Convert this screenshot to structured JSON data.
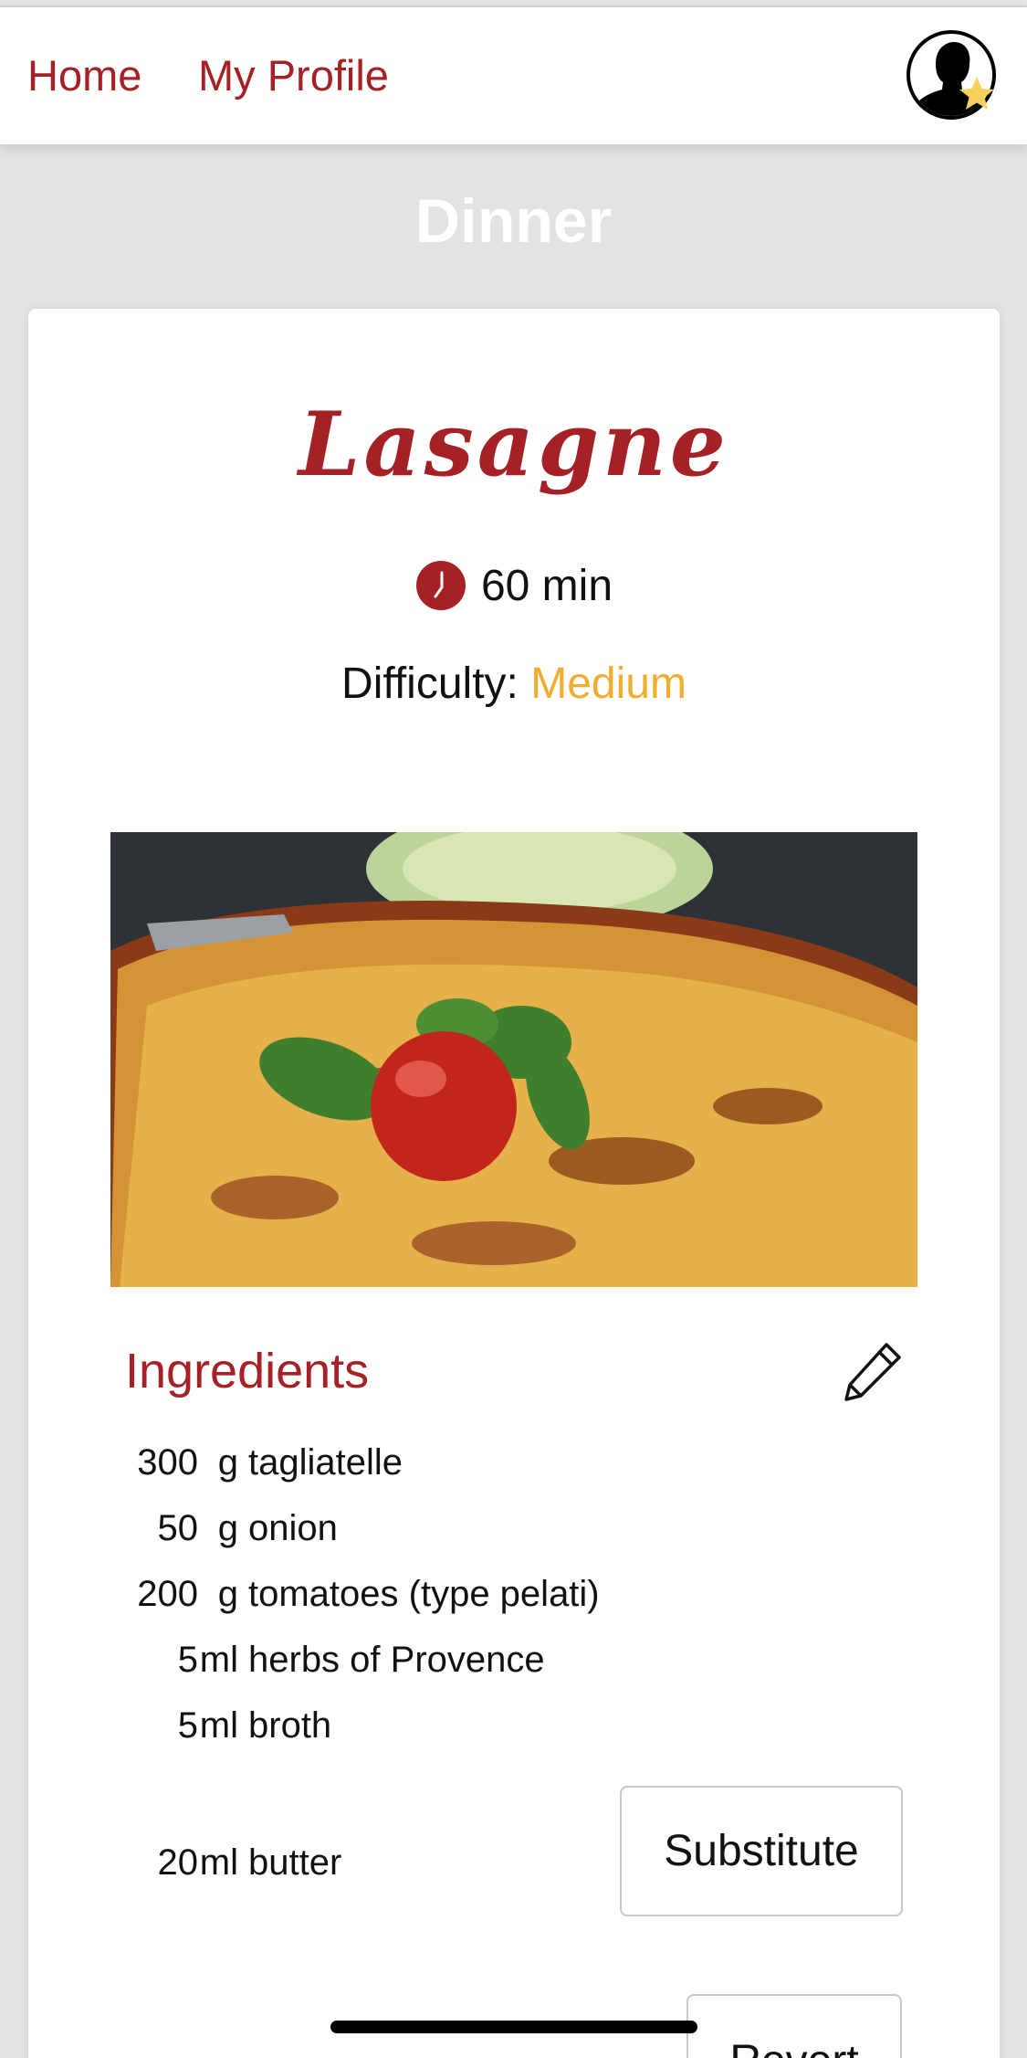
{
  "nav": {
    "home_label": "Home",
    "profile_label": "My Profile",
    "avatar_icon": "user-avatar-with-star-icon"
  },
  "category": "Dinner",
  "recipe": {
    "title": "Lasagne",
    "time_icon": "clock-icon",
    "time": "60 min",
    "difficulty_label": "Difficulty:",
    "difficulty_value": "Medium",
    "image_alt": "lasagne dish with tomato and basil"
  },
  "ingredients": {
    "title": "Ingredients",
    "edit_icon": "pencil-icon",
    "items": [
      {
        "qty": "300",
        "unit": "g",
        "name": "tagliatelle"
      },
      {
        "qty": "50",
        "unit": "g",
        "name": "onion"
      },
      {
        "qty": "200",
        "unit": "g",
        "name": "tomatoes (type pelati)"
      },
      {
        "qty": "5",
        "unit": "ml",
        "name": "herbs of Provence"
      },
      {
        "qty": "5",
        "unit": "ml",
        "name": "broth"
      },
      {
        "qty": "20",
        "unit": "ml",
        "name": "butter"
      }
    ],
    "substitute_label": "Substitute",
    "revert_label": "Revert"
  },
  "colors": {
    "accent": "#a52126",
    "difficulty": "#f0ad2f",
    "background": "#e4e3e1"
  }
}
